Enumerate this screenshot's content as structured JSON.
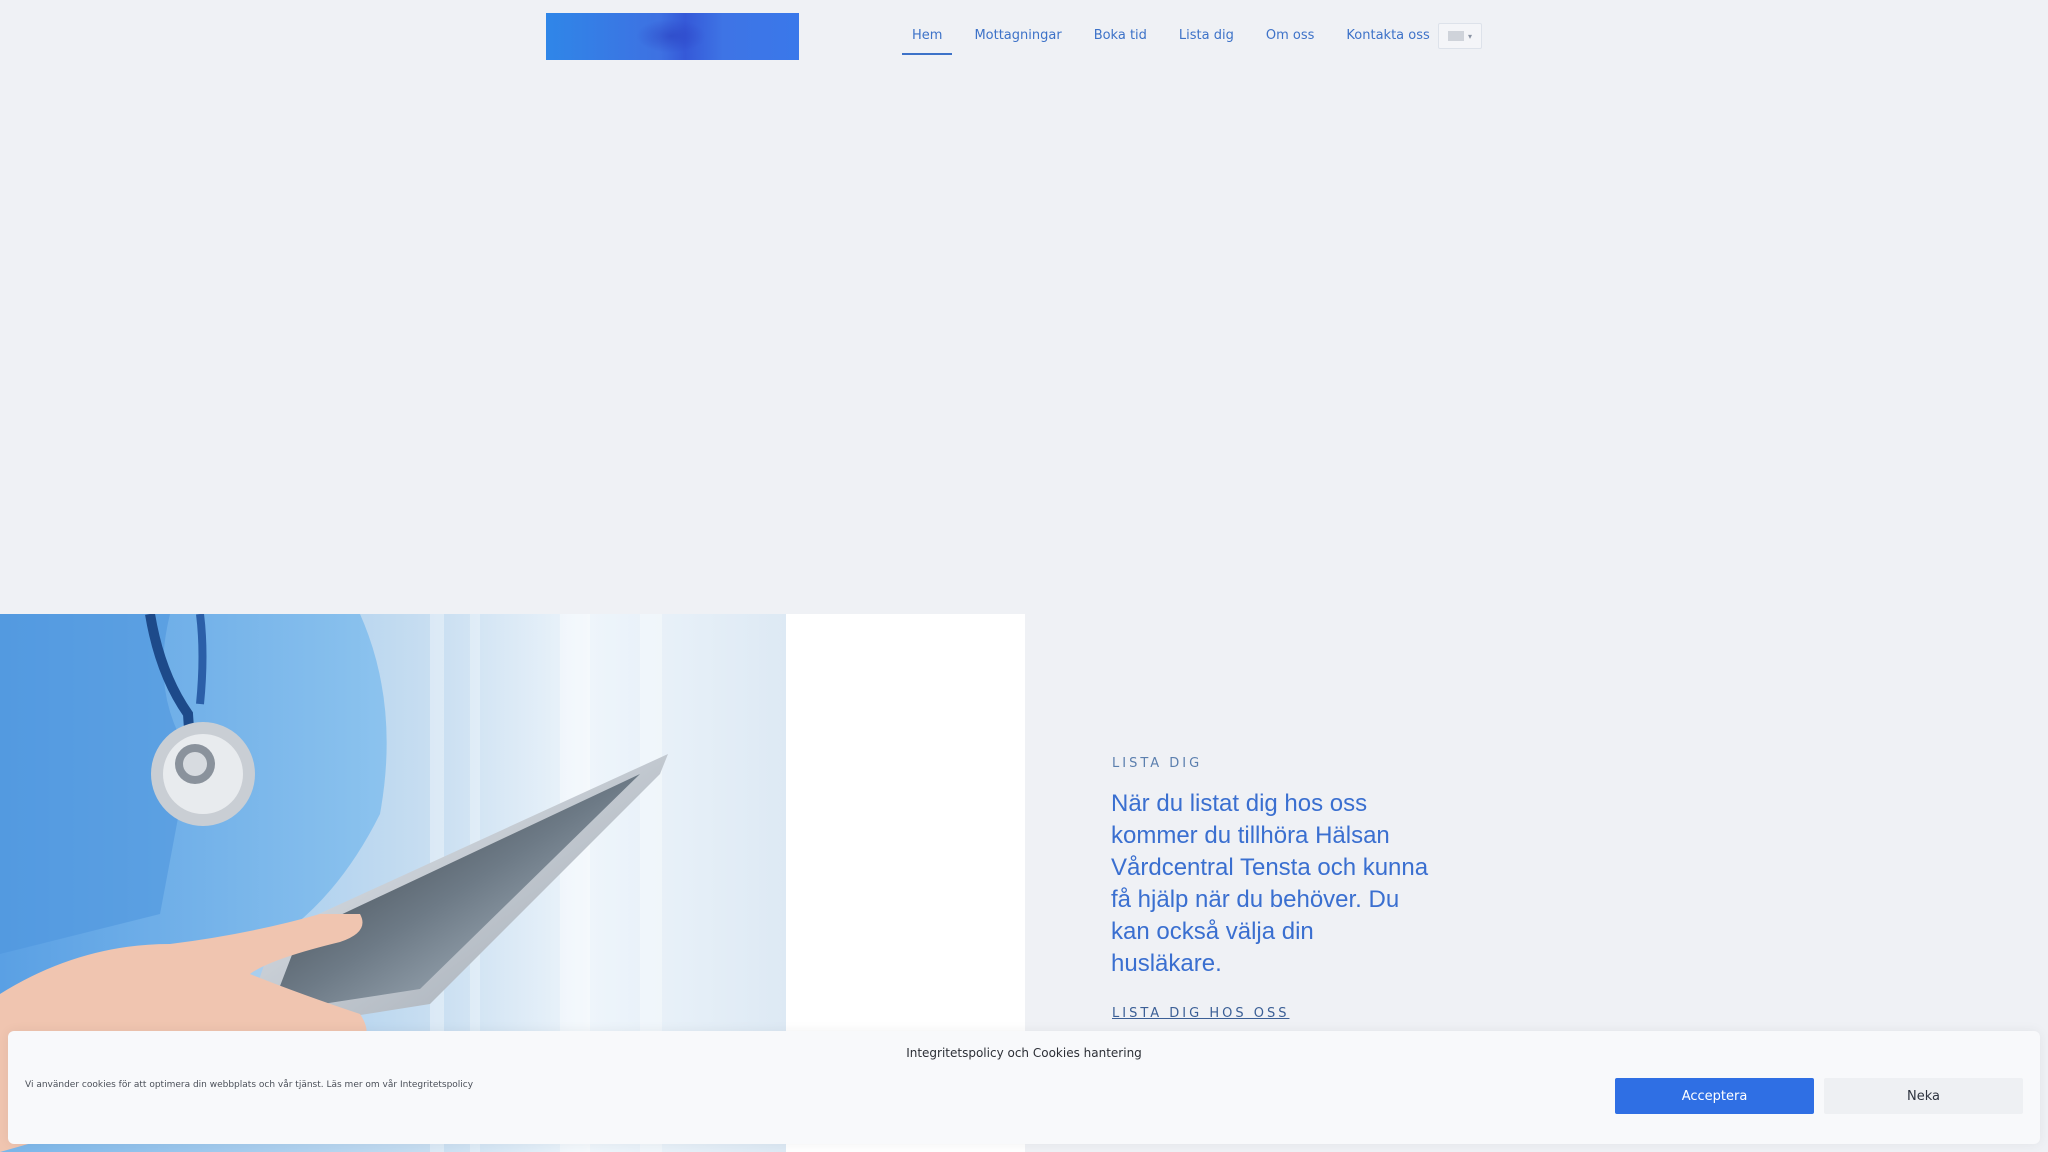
{
  "header": {
    "nav": [
      {
        "label": "Hem",
        "active": true
      },
      {
        "label": "Mottagningar",
        "active": false
      },
      {
        "label": "Boka tid",
        "active": false
      },
      {
        "label": "Lista dig",
        "active": false
      },
      {
        "label": "Om oss",
        "active": false
      },
      {
        "label": "Kontakta oss",
        "active": false
      }
    ],
    "language_icon": "flag-icon"
  },
  "hero": {
    "image": "nurse-with-tablet-and-stethoscope"
  },
  "section": {
    "label": "LISTA DIG",
    "text": "När du listat dig hos oss kommer du tillhöra Hälsan Vårdcentral Tensta och kunna få hjälp när du behöver. Du kan också välja din husläkare.",
    "link": "LISTA DIG HOS OSS"
  },
  "cookie": {
    "title": "Integritetspolicy och Cookies hantering",
    "text": "Vi använder cookies för att optimera din webbplats och vår tjänst. Läs mer om vår Integritetspolicy",
    "accept": "Acceptera",
    "deny": "Neka"
  },
  "colors": {
    "accent": "#2f6fe4",
    "nav_text": "#3d72c8",
    "background": "#eff1f5"
  }
}
